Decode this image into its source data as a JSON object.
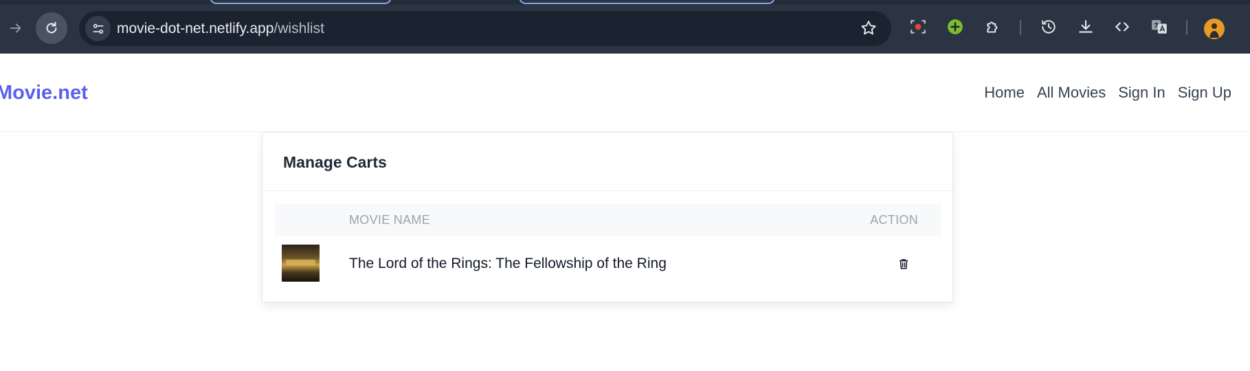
{
  "browser": {
    "url_host": "movie-dot-net.netlify.app",
    "url_path": "/wishlist",
    "icons": [
      "forward-icon",
      "reload-icon",
      "site-info-icon",
      "star-icon",
      "screen-record-icon",
      "add-extension-icon",
      "extensions-icon",
      "history-icon",
      "download-icon",
      "devtools-icon",
      "translate-icon",
      "avatar"
    ]
  },
  "site": {
    "logo": "Movie.net",
    "nav": [
      "Home",
      "All Movies",
      "Sign In",
      "Sign Up"
    ]
  },
  "cart": {
    "title": "Manage Carts",
    "columns": {
      "name": "MOVIE NAME",
      "action": "ACTION"
    },
    "rows": [
      {
        "name": "The Lord of the Rings: The Fellowship of the Ring"
      }
    ]
  },
  "colors": {
    "brand": "#5b5ff0",
    "chrome": "#2b3443",
    "omnibox": "#1c2330"
  }
}
